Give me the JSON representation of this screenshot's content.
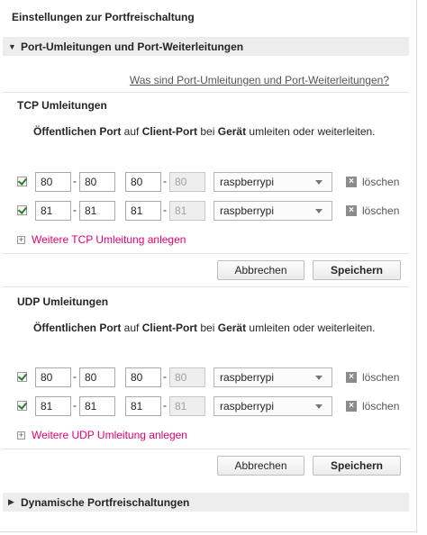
{
  "page_title": "Einstellungen zur Portfreischaltung",
  "section_port": "Port-Umleitungen und Port-Weiterleitungen",
  "help_link": "Was sind Port-Umleitungen und Port-Weiterleitungen?",
  "desc": {
    "part1": "Öffentlichen Port",
    "part2": " auf ",
    "part3": "Client-Port",
    "part4": " bei ",
    "part5": "Gerät",
    "part6": " umleiten oder weiterleiten."
  },
  "tcp": {
    "title": "TCP Umleitungen",
    "rows": [
      {
        "pub_from": "80",
        "pub_to": "80",
        "cli_from": "80",
        "cli_to": "80",
        "device": "raspberrypi",
        "delete": "löschen",
        "checked": true
      },
      {
        "pub_from": "81",
        "pub_to": "81",
        "cli_from": "81",
        "cli_to": "81",
        "device": "raspberrypi",
        "delete": "löschen",
        "checked": true
      }
    ],
    "add": "Weitere TCP Umleitung anlegen",
    "cancel": "Abbrechen",
    "save": "Speichern"
  },
  "udp": {
    "title": "UDP Umleitungen",
    "rows": [
      {
        "pub_from": "80",
        "pub_to": "80",
        "cli_from": "80",
        "cli_to": "80",
        "device": "raspberrypi",
        "delete": "löschen",
        "checked": true
      },
      {
        "pub_from": "81",
        "pub_to": "81",
        "cli_from": "81",
        "cli_to": "81",
        "device": "raspberrypi",
        "delete": "löschen",
        "checked": true
      }
    ],
    "add": "Weitere UDP Umleitung anlegen",
    "cancel": "Abbrechen",
    "save": "Speichern"
  },
  "section_dynamic": "Dynamische Portfreischaltungen",
  "dash": "-",
  "colors": {
    "accent": "#e20074",
    "section_bg": "#ededed"
  }
}
